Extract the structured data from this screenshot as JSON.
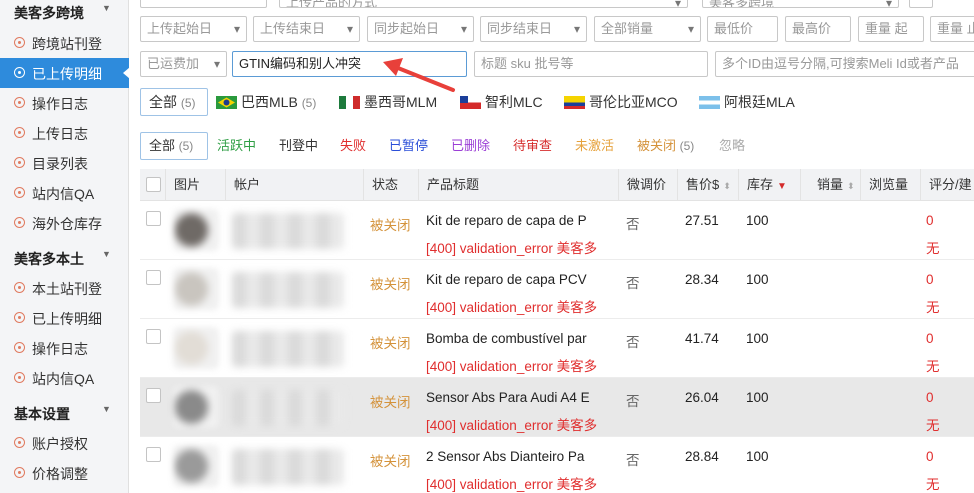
{
  "sidebar": {
    "sections": [
      {
        "title": "美客多跨境",
        "items": [
          {
            "label": "跨境站刊登",
            "active": false
          },
          {
            "label": "已上传明细",
            "active": true
          },
          {
            "label": "操作日志",
            "active": false
          },
          {
            "label": "上传日志",
            "active": false
          },
          {
            "label": "目录列表",
            "active": false
          },
          {
            "label": "站内信QA",
            "active": false
          },
          {
            "label": "海外仓库存",
            "active": false
          }
        ]
      },
      {
        "title": "美客多本土",
        "items": [
          {
            "label": "本土站刊登",
            "active": false
          },
          {
            "label": "已上传明细",
            "active": false
          },
          {
            "label": "操作日志",
            "active": false
          },
          {
            "label": "站内信QA",
            "active": false
          }
        ]
      },
      {
        "title": "基本设置",
        "items": [
          {
            "label": "账户授权",
            "active": false
          },
          {
            "label": "价格调整",
            "active": false
          }
        ]
      }
    ]
  },
  "filters": {
    "top_partial": [
      "",
      "上传产品的方式",
      "美客多跨境"
    ],
    "row1": [
      "上传起始日",
      "上传结束日",
      "同步起始日",
      "同步结束日",
      "全部销量",
      "最低价",
      "最高价",
      "重量 起",
      "重量 止"
    ],
    "row2": {
      "shipping_fee": "已运费加",
      "search_value": "GTIN编码和别人冲突",
      "sku_placeholder": "标题 sku 批号等",
      "ids_placeholder": "多个ID由逗号分隔,可搜索Meli Id或者产品"
    }
  },
  "markets": [
    {
      "label": "全部",
      "count": "(5)"
    },
    {
      "label": "巴西MLB",
      "count": "(5)"
    },
    {
      "label": "墨西哥MLM",
      "count": ""
    },
    {
      "label": "智利MLC",
      "count": ""
    },
    {
      "label": "哥伦比亚MCO",
      "count": ""
    },
    {
      "label": "阿根廷MLA",
      "count": ""
    }
  ],
  "status_tabs": [
    {
      "label": "全部",
      "count": "(5)",
      "color": "#333333"
    },
    {
      "label": "活跃中",
      "count": "",
      "color": "#2e9e44"
    },
    {
      "label": "刊登中",
      "count": "",
      "color": "#333333"
    },
    {
      "label": "失败",
      "count": "",
      "color": "#e02e2e"
    },
    {
      "label": "已暂停",
      "count": "",
      "color": "#2b4fd8"
    },
    {
      "label": "已删除",
      "count": "",
      "color": "#9b3fd6"
    },
    {
      "label": "待审查",
      "count": "",
      "color": "#d62e2e"
    },
    {
      "label": "未激活",
      "count": "",
      "color": "#e6a23c"
    },
    {
      "label": "被关闭",
      "count": "(5)",
      "color": "#d4923a"
    },
    {
      "label": "忽略",
      "count": "",
      "color": "#aaaaaa"
    }
  ],
  "table": {
    "columns": [
      "图片",
      "帐户",
      "状态",
      "产品标题",
      "微调价",
      "售价$",
      "库存",
      "销量",
      "浏览量",
      "评分/建"
    ],
    "rows": [
      {
        "status": "被关闭",
        "title": "Kit de reparo de capa de P",
        "error": "[400] validation_error 美客多",
        "adjust": "否",
        "price": "27.51",
        "stock": "100",
        "rating": "0",
        "rating2": "无",
        "highlighted": false
      },
      {
        "status": "被关闭",
        "title": "Kit de reparo de capa PCV",
        "error": "[400] validation_error 美客多",
        "adjust": "否",
        "price": "28.34",
        "stock": "100",
        "rating": "0",
        "rating2": "无",
        "highlighted": false
      },
      {
        "status": "被关闭",
        "title": "Bomba de combustível par",
        "error": "[400] validation_error 美客多",
        "adjust": "否",
        "price": "41.74",
        "stock": "100",
        "rating": "0",
        "rating2": "无",
        "highlighted": false
      },
      {
        "status": "被关闭",
        "title": "Sensor Abs Para Audi A4 E",
        "error": "[400] validation_error 美客多",
        "adjust": "否",
        "price": "26.04",
        "stock": "100",
        "rating": "0",
        "rating2": "无",
        "highlighted": true
      },
      {
        "status": "被关闭",
        "title": "2 Sensor Abs Dianteiro Pa",
        "error": "[400] validation_error 美客多",
        "adjust": "否",
        "price": "28.84",
        "stock": "100",
        "rating": "0",
        "rating2": "无",
        "highlighted": false
      }
    ]
  },
  "colors": {
    "accent": "#2e8bdc",
    "closed": "#d4923a",
    "error": "#e02e2e",
    "arrow": "#e8403a"
  }
}
